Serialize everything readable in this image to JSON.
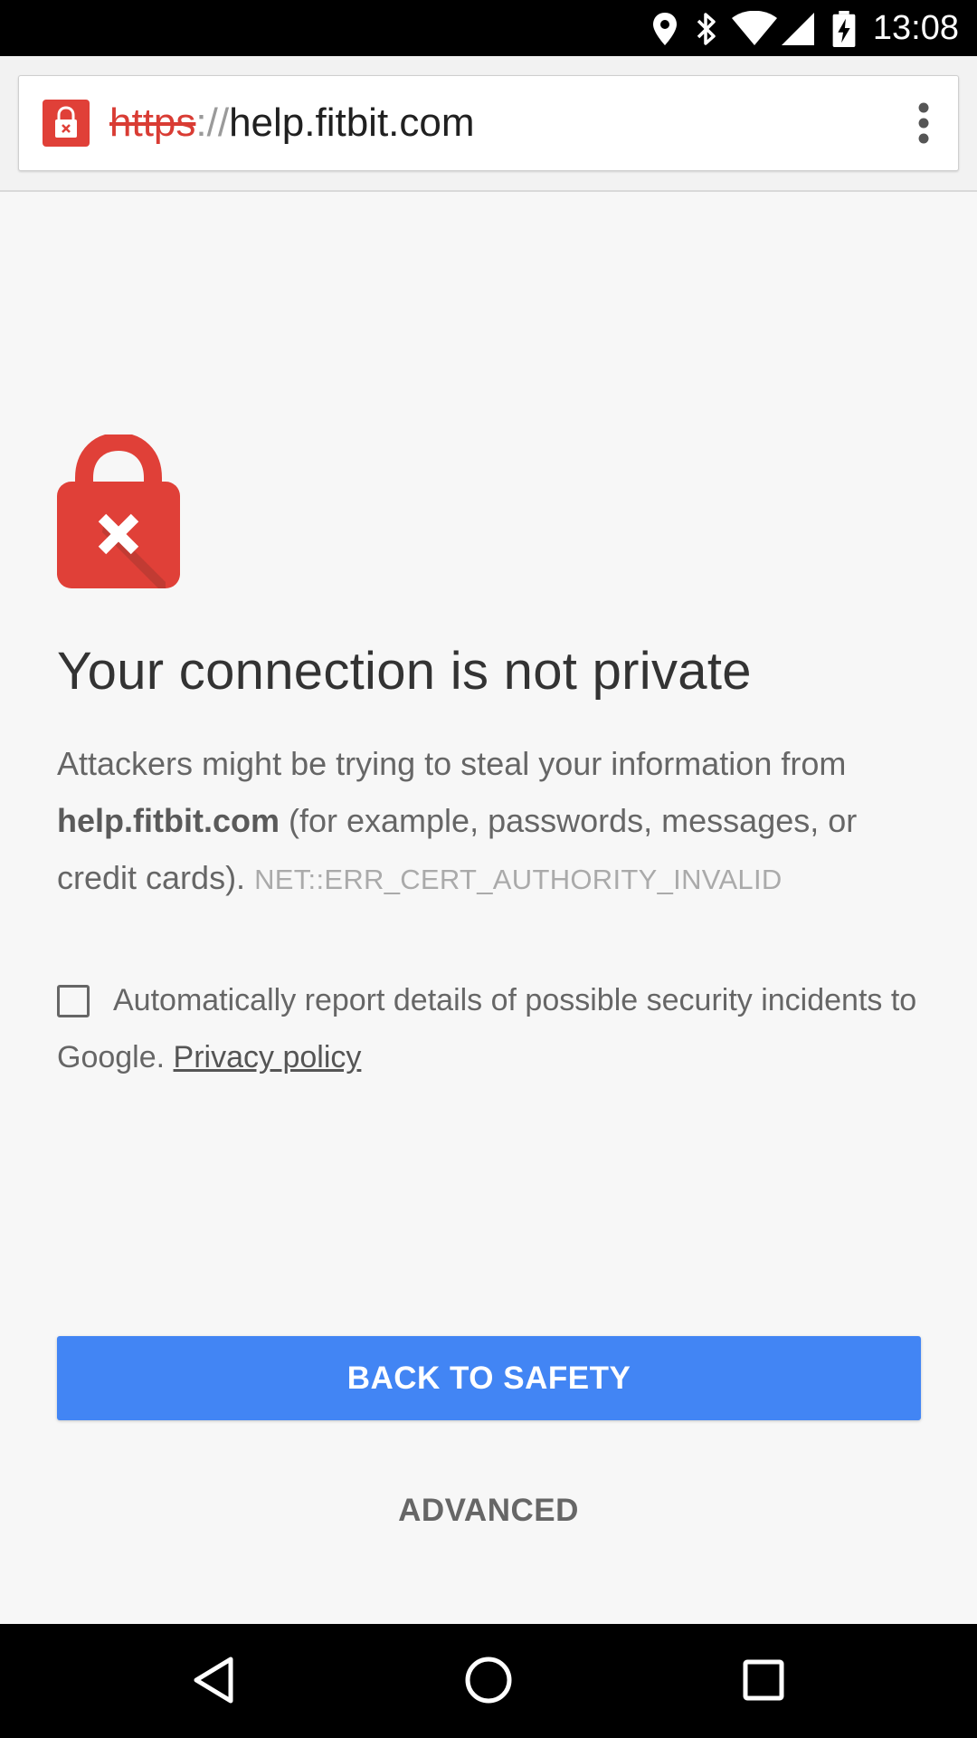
{
  "status_bar": {
    "time": "13:08",
    "icons": [
      "location-icon",
      "bluetooth-icon",
      "wifi-icon",
      "cell-signal-icon",
      "battery-charging-icon"
    ]
  },
  "toolbar": {
    "url_scheme": "https",
    "url_separator": "://",
    "url_host": "help.fitbit.com",
    "security_icon": "broken-lock-icon",
    "menu_icon": "overflow-menu-icon",
    "security_color": "#e04038"
  },
  "interstitial": {
    "icon": "lock-error-icon",
    "heading": "Your connection is not private",
    "body_prefix": "Attackers might be trying to steal your information from ",
    "body_host": "help.fitbit.com",
    "body_suffix": " (for example, passwords, messages, or credit cards). ",
    "error_code": "NET::ERR_CERT_AUTHORITY_INVALID",
    "report_text": "Automatically report details of possible security incidents to Google. ",
    "privacy_link": "Privacy policy",
    "report_checked": false,
    "primary_button": "BACK TO SAFETY",
    "secondary_button": "ADVANCED",
    "primary_color": "#4285f4"
  },
  "nav_bar": {
    "back_icon": "back-triangle-icon",
    "home_icon": "home-circle-icon",
    "recents_icon": "recents-square-icon"
  }
}
